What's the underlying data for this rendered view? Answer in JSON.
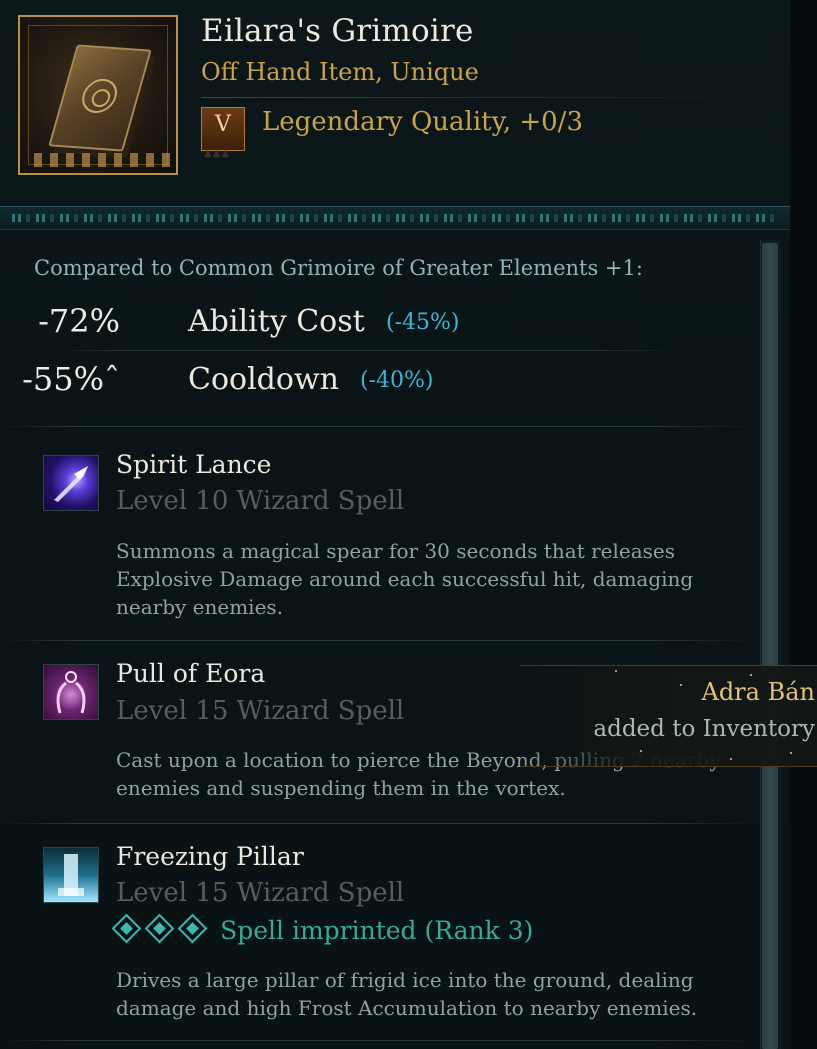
{
  "item": {
    "name": "Eilara's Grimoire",
    "type": "Off Hand Item, Unique",
    "rank_numeral": "V",
    "quality": "Legendary Quality, +0/3",
    "icon": "grimoire-book-icon"
  },
  "comparison": {
    "header": "Compared to Common Grimoire of Greater Elements +1:",
    "stats": [
      {
        "value": "-72%",
        "name": "Ability Cost",
        "delta": "(-45%)"
      },
      {
        "value": "-55%ˆ",
        "name": "Cooldown",
        "delta": "(-40%)"
      }
    ]
  },
  "spells": [
    {
      "name": "Spirit Lance",
      "level": "Level 10 Wizard Spell",
      "icon": "spirit-lance-icon",
      "description": "Summons a magical spear for 30 seconds that releases Explosive Damage around each successful hit, damaging nearby enemies."
    },
    {
      "name": "Pull of Eora",
      "level": "Level 15 Wizard Spell",
      "icon": "pull-of-eora-icon",
      "description": "Cast upon a location to pierce the Beyond, pulling 2 nearby enemies and suspending them in the vortex."
    },
    {
      "name": "Freezing Pillar",
      "level": "Level 15 Wizard Spell",
      "icon": "freezing-pillar-icon",
      "imprint": "Spell imprinted (Rank 3)",
      "imprint_rank": 3,
      "description": "Drives a large pillar of frigid ice into the ground, dealing damage and high Frost Accumulation to nearby enemies."
    }
  ],
  "notification": {
    "item_name": "Adra Bán",
    "message": "added to Inventory"
  },
  "colors": {
    "accent_gold": "#c9a24a",
    "delta_blue": "#3fb5d6",
    "imprint_teal": "#39aa98",
    "background": "#0a1416"
  }
}
